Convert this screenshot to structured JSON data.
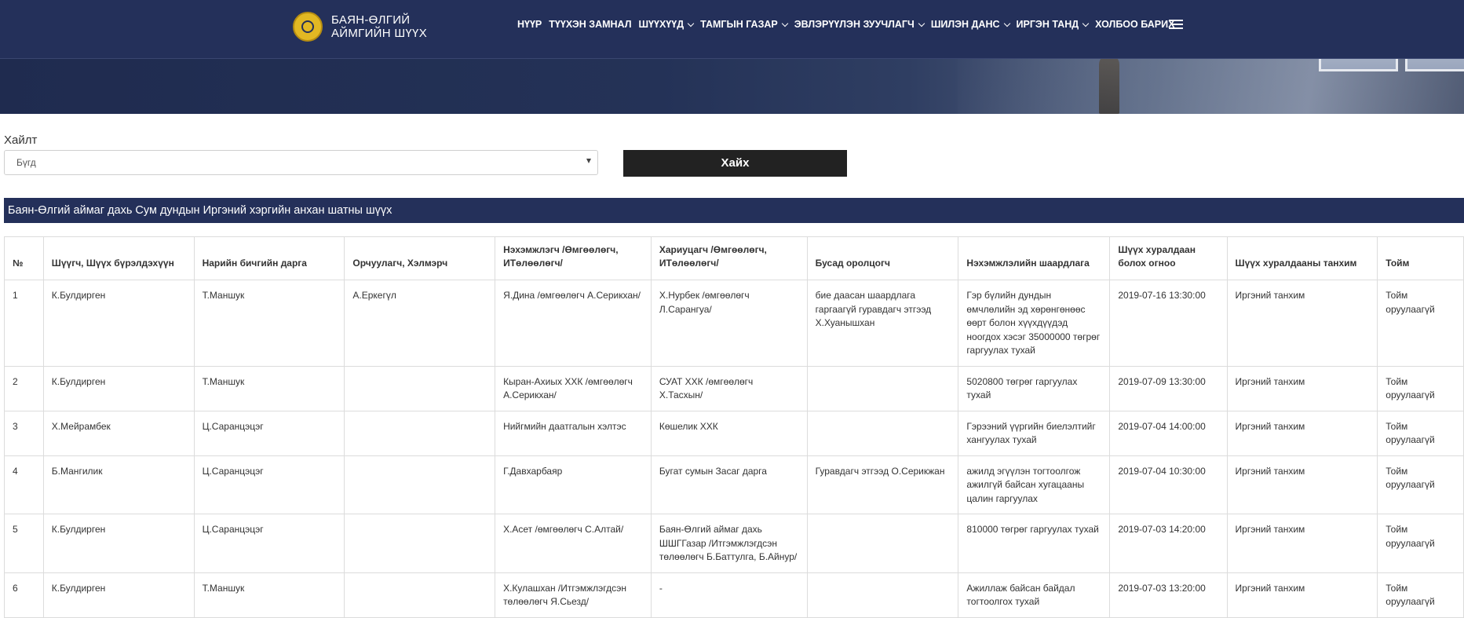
{
  "header": {
    "brand_line1": "БАЯН-ӨЛГИЙ",
    "brand_line2": "АЙМГИЙН ШҮҮХ",
    "nav": [
      {
        "label": "НҮҮР",
        "dropdown": false
      },
      {
        "label": "ТҮҮХЭН ЗАМНАЛ",
        "dropdown": false
      },
      {
        "label": "ШҮҮХҮҮД",
        "dropdown": true
      },
      {
        "label": "ТАМГЫН ГАЗАР",
        "dropdown": true
      },
      {
        "label": "ЭВЛЭРҮҮЛЭН ЗУУЧЛАГЧ",
        "dropdown": true
      },
      {
        "label": "ШИЛЭН ДАНС",
        "dropdown": true
      },
      {
        "label": "ИРГЭН ТАНД",
        "dropdown": true
      },
      {
        "label": "ХОЛБОО БАРИХ",
        "dropdown": false
      }
    ]
  },
  "search": {
    "label": "Хайлт",
    "selected": "Бүгд",
    "button": "Хайх"
  },
  "section_title": "Баян-Өлгий аймаг дахь Сум дундын Иргэний хэргийн анхан шатны шүүх",
  "table": {
    "headers": [
      "№",
      "Шүүгч, Шүүх бүрэлдэхүүн",
      "Нарийн бичгийн дарга",
      "Орчуулагч, Хэлмэрч",
      "Нэхэмжлэгч /Өмгөөлөгч, ИТөлөөлөгч/",
      "Хариуцагч /Өмгөөлөгч, ИТөлөөлөгч/",
      "Бусад оролцогч",
      "Нэхэмжлэлийн шаардлага",
      "Шүүх хуралдаан болох огноо",
      "Шүүх хуралдааны танхим",
      "Тойм"
    ],
    "rows": [
      [
        "1",
        "К.Булдирген",
        "Т.Маншук",
        "А.Еркегүл",
        "Я.Дина /өмгөөлөгч А.Серикхан/",
        "Х.Нурбек /өмгөөлөгч Л.Сарангуа/",
        "бие даасан шаардлага гаргаагүй гуравдагч этгээд Х.Хуанышхан",
        "Гэр бүлийн дундын өмчлөлийн эд хөрөнгөнөөс өөрт болон хүүхдүүдэд ноогдох хэсэг 35000000 төгрөг гаргуулах тухай",
        "2019-07-16 13:30:00",
        "Иргэний танхим",
        "Тойм оруулаагүй"
      ],
      [
        "2",
        "К.Булдирген",
        "Т.Маншук",
        "",
        "Кыран-Ахиых ХХК /өмгөөлөгч А.Серикхан/",
        "СУАТ ХХК /өмгөөлөгч Х.Тасхын/",
        "",
        "5020800 төгрөг гаргуулах тухай",
        "2019-07-09 13:30:00",
        "Иргэний танхим",
        "Тойм оруулаагүй"
      ],
      [
        "3",
        "Х.Мейрамбек",
        "Ц.Саранцэцэг",
        "",
        "Нийгмийн даатгалын хэлтэс",
        "Көшелик ХХК",
        "",
        "Гэрээний үүргийн биелэлтийг хангуулах тухай",
        "2019-07-04 14:00:00",
        "Иргэний танхим",
        "Тойм оруулаагүй"
      ],
      [
        "4",
        "Б.Мангилик",
        "Ц.Саранцэцэг",
        "",
        "Г.Давхарбаяр",
        "Бугат сумын Засаг дарга",
        "Гуравдагч этгээд О.Серикжан",
        "ажилд эгүүлэн тогтоолгож ажилгүй байсан хугацааны цалин гаргуулах",
        "2019-07-04 10:30:00",
        "Иргэний танхим",
        "Тойм оруулаагүй"
      ],
      [
        "5",
        "К.Булдирген",
        "Ц.Саранцэцэг",
        "",
        "Х.Асет /өмгөөлөгч С.Алтай/",
        "Баян-Өлгий аймаг дахь ШШГГазар /Итгэмжлэгдсэн төлөөлөгч Б.Баттулга, Б.Айнур/",
        "",
        "810000 төгрөг гаргуулах тухай",
        "2019-07-03 14:20:00",
        "Иргэний танхим",
        "Тойм оруулаагүй"
      ],
      [
        "6",
        "К.Булдирген",
        "Т.Маншук",
        "",
        "Х.Кулашхан /Итгэмжлэгдсэн төлөөлөгч Я.Сьезд/",
        "-",
        "",
        "Ажиллаж байсан байдал тогтоолгох тухай",
        "2019-07-03 13:20:00",
        "Иргэний танхим",
        "Тойм оруулаагүй"
      ]
    ]
  }
}
